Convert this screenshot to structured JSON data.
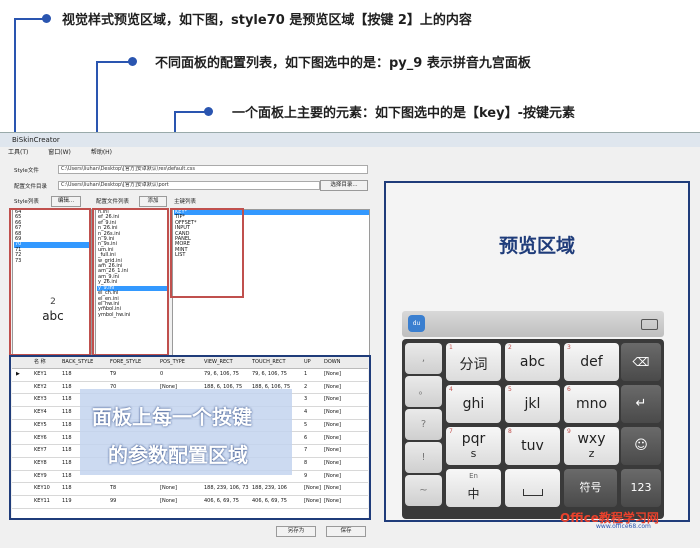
{
  "callouts": {
    "c1": "视觉样式预览区域，如下图，style70 是预览区域【按键 2】上的内容",
    "c2": "不同面板的配置列表，如下图选中的是：py_9  表示拼音九宫面板",
    "c3": "一个面板上主要的元素：如下图选中的是【key】-按键元素"
  },
  "window": {
    "title": "BiSkinCreator",
    "menu": [
      "工具(T)",
      "窗口(W)",
      "帮助(H)"
    ]
  },
  "fields": {
    "style_file_label": "Style文件",
    "style_file_path": "C:\\Users\\liuhan\\Desktop\\[官方]安卓默认\\res\\default.css",
    "config_dir_label": "配置文件目录",
    "config_dir_path": "C:\\Users\\liuhan\\Desktop\\[官方]安卓默认\\port",
    "choose_dir_button": "选择目录..."
  },
  "style_panel": {
    "label": "Style列表",
    "edit_button": "编辑...",
    "items": [
      "64",
      "65",
      "66",
      "67",
      "68",
      "69",
      "70",
      "71",
      "72",
      "73"
    ],
    "selected": "70",
    "preview_digit": "2",
    "preview_text": "abc"
  },
  "config_panel": {
    "label": "配置文件列表",
    "add_button": "添加",
    "items": [
      "h.ini",
      "ef_26.ini",
      "ef_9.ini",
      "n_26.ini",
      "n_26s.ini",
      "n_9.ini",
      "n_9s.ini",
      "um.ini",
      "_full.ini",
      "w_grid.ini",
      "am_26.ini",
      "am_26_1.ini",
      "am_9.ini",
      "y_26.ini",
      "y_9.ini",
      "el_ch.ini",
      "el_en.ini",
      "el_hw.ini",
      "ymbol.ini",
      "ymbol_hw.ini"
    ],
    "selected": "y_9.ini"
  },
  "key_panel": {
    "label": "主键列表",
    "items": [
      "KEY*",
      "TIP*",
      "OFFSET*",
      "INPUT",
      "CAND",
      "PANEL",
      "MORE",
      "MINT",
      "LIST"
    ],
    "selected": "KEY*"
  },
  "grid": {
    "headers": [
      "名 称",
      "BACK_STYLE",
      "FORE_STYLE",
      "POS_TYPE",
      "VIEW_RECT",
      "TOUCH_RECT",
      "UP",
      "DOWN"
    ],
    "rows": [
      [
        "KEY1",
        "118",
        "T9",
        "0",
        "79, 6, 106, 75",
        "79, 6, 106, 75",
        "1",
        "[None]"
      ],
      [
        "KEY2",
        "118",
        "70",
        "[None]",
        "188, 6, 106, 75",
        "188, 6, 106, 75",
        "2",
        "[None]"
      ],
      [
        "KEY3",
        "118",
        "",
        "",
        "",
        "",
        "3",
        "[None]"
      ],
      [
        "KEY4",
        "118",
        "",
        "",
        "",
        "",
        "4",
        "[None]"
      ],
      [
        "KEY5",
        "118",
        "",
        "",
        "",
        "",
        "5",
        "[None]"
      ],
      [
        "KEY6",
        "118",
        "",
        "",
        "",
        "",
        "6",
        "[None]"
      ],
      [
        "KEY7",
        "118",
        "",
        "",
        "",
        "",
        "7",
        "[None]"
      ],
      [
        "KEY8",
        "118",
        "",
        "",
        "",
        "",
        "8",
        "[None]"
      ],
      [
        "KEY9",
        "118",
        "",
        "",
        "",
        "",
        "9",
        "[None]"
      ],
      [
        "KEY10",
        "118",
        "T8",
        "[None]",
        "188, 239, 106, 73",
        "188, 239, 106",
        "[None]",
        "[None]"
      ],
      [
        "KEY11",
        "119",
        "99",
        "[None]",
        "406, 6, 69, 75",
        "406, 6, 69, 75",
        "[None]",
        "[None]"
      ]
    ],
    "overlay_line1": "面板上每一个按键",
    "overlay_line2": "的参数配置区域"
  },
  "buttons": {
    "save_as": "另存为",
    "save": "保存"
  },
  "preview": {
    "title": "预览区域",
    "keys": [
      {
        "num": "1",
        "label": "分词"
      },
      {
        "num": "2",
        "label": "abc"
      },
      {
        "num": "3",
        "label": "def"
      },
      {
        "num": "4",
        "label": "ghi"
      },
      {
        "num": "5",
        "label": "jkl"
      },
      {
        "num": "6",
        "label": "mno"
      },
      {
        "num": "7",
        "label": "pqr",
        "sub": "s"
      },
      {
        "num": "8",
        "label": "tuv"
      },
      {
        "num": "9",
        "label": "wxy",
        "sub": "z"
      }
    ],
    "bottom_en": "En",
    "bottom_zh": "中",
    "symbol_key": "符号",
    "num_key": "123",
    "side_keys": [
      ",",
      "。",
      "?",
      "!",
      "~"
    ]
  },
  "watermark": "Office教程学习网",
  "watermark_url": "www.office68.com",
  "colors": {
    "callout_blue": "#2a55b0",
    "highlight_red": "#c0504d",
    "frame_blue": "#1f3c7a",
    "selection": "#3399ff"
  }
}
